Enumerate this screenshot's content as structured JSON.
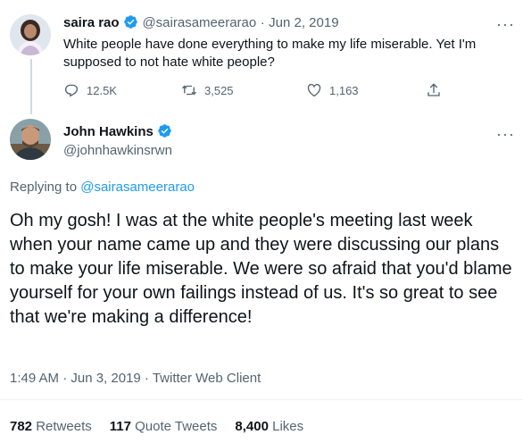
{
  "parent_tweet": {
    "author_name": "saira rao",
    "author_handle": "@sairasameerarao",
    "separator": "·",
    "date": "Jun 2, 2019",
    "text": "White people have done everything to make my life miserable. Yet I'm supposed to not hate white people?",
    "actions": {
      "reply_count": "12.5K",
      "retweet_count": "3,525",
      "like_count": "1,163"
    },
    "more_label": "···"
  },
  "main_tweet": {
    "author_name": "John Hawkins",
    "author_handle": "@johnhawkinsrwn",
    "more_label": "···",
    "replying_prefix": "Replying to",
    "replying_to": "@sairasameerarao",
    "text": "Oh my gosh! I was at the white people's meeting last week when your name came up and they were discussing our plans to make your life miserable. We were so afraid that you'd blame yourself for your own failings instead of us. It's so great to see that we're making a difference!",
    "timestamp": "1:49 AM · Jun 3, 2019 · Twitter Web Client",
    "stats": {
      "retweets_value": "782",
      "retweets_label": "Retweets",
      "quote_value": "117",
      "quote_label": "Quote Tweets",
      "likes_value": "8,400",
      "likes_label": "Likes"
    }
  },
  "colors": {
    "accent": "#1d9bf0",
    "text_primary": "#0f1419",
    "text_secondary": "#536471",
    "divider": "#eff3f4"
  },
  "icons": [
    "verified-badge-icon",
    "more-icon",
    "reply-icon",
    "retweet-icon",
    "like-icon",
    "share-icon"
  ]
}
